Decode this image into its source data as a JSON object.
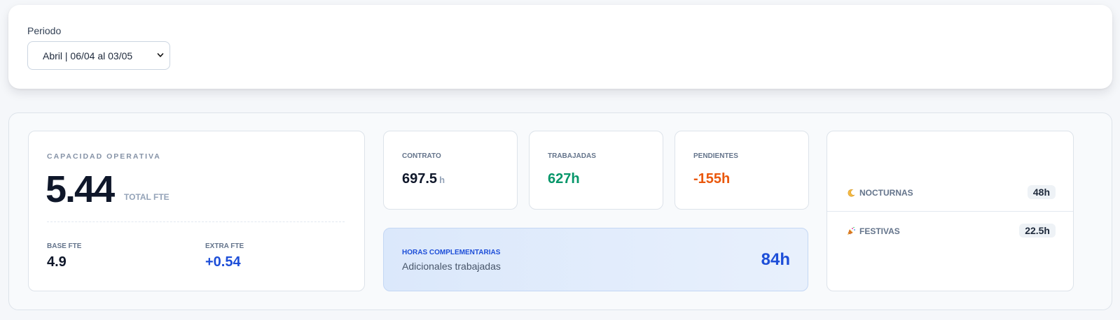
{
  "period": {
    "label": "Periodo",
    "selected": "Abril | 06/04 al 03/05"
  },
  "capacity": {
    "title": "CAPACIDAD OPERATIVA",
    "value": "5.44",
    "unit": "TOTAL FTE",
    "base_label": "BASE FTE",
    "base_value": "4.9",
    "extra_label": "EXTRA FTE",
    "extra_value": "+0.54"
  },
  "contract": {
    "label": "CONTRATO",
    "value": "697.5",
    "unit": "h"
  },
  "worked": {
    "label": "TRABAJADAS",
    "value": "627h"
  },
  "pending": {
    "label": "PENDIENTES",
    "value": "-155h"
  },
  "extra_hours": {
    "title": "HORAS COMPLEMENTARIAS",
    "subtitle": "Adicionales trabajadas",
    "value": "84h"
  },
  "special": {
    "night_label": "NOCTURNAS",
    "night_icon": "moon-icon",
    "night_value": "48h",
    "holiday_label": "FESTIVAS",
    "holiday_icon": "party-popper-icon",
    "holiday_value": "22.5h"
  },
  "colors": {
    "worked": "#059669",
    "pending": "#ea580c",
    "extra": "#1d4ed8"
  }
}
